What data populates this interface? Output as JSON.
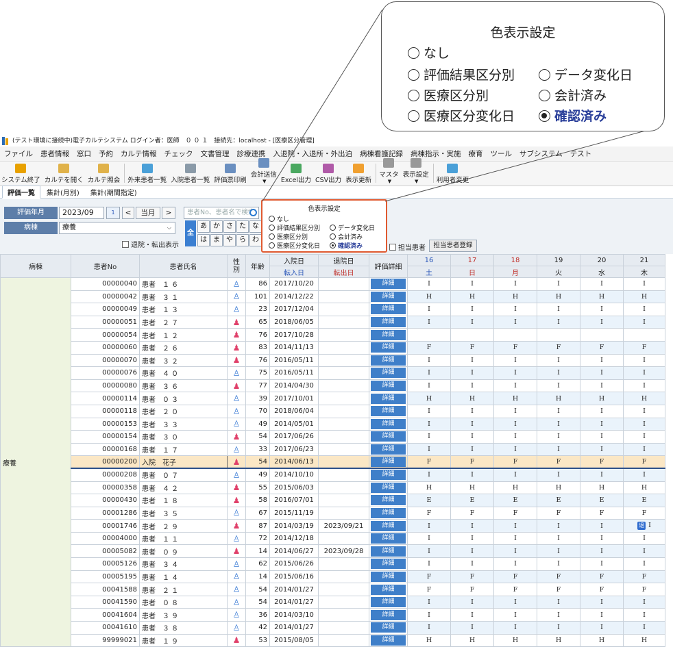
{
  "callout": {
    "title": "色表示設定",
    "options": [
      [
        "なし"
      ],
      [
        "評価結果区分別",
        "データ変化日"
      ],
      [
        "医療区分別",
        "会計済み"
      ],
      [
        "医療区分変化日",
        "確認済み"
      ]
    ]
  },
  "window": {
    "title": "(テスト環境に接続中)電子カルテシステム  ログイン者：医師　０ ０ １　接続先：localhost - [医療区分管理]"
  },
  "menu": [
    "ファイル",
    "患者情報",
    "窓口",
    "予約",
    "カルテ情報",
    "チェック",
    "文書管理",
    "診療連携",
    "入退院・入退所・外出泊",
    "病棟看護記録",
    "病棟指示・実施",
    "療育",
    "ツール",
    "サブシステム",
    "テスト"
  ],
  "toolbar": [
    "システム終了",
    "カルテを開く",
    "カルテ照会",
    "外来患者一覧",
    "入院患者一覧",
    "評価票印刷",
    "会計送信",
    "Excel出力",
    "CSV出力",
    "表示更新",
    "マスタ",
    "表示設定",
    "利用者変更"
  ],
  "tabs": [
    "評価一覧",
    "集計(月別)",
    "集計(期間指定)"
  ],
  "filters": {
    "month_label": "評価年月",
    "month_value": "2023/09",
    "calendar_glyph": "1",
    "prev": "<",
    "current": "当月",
    "next": ">",
    "ward_label": "病棟",
    "ward_value": "療養",
    "search_placeholder": "患者No、患者名で検索",
    "kana_all": "全",
    "kana_row1": [
      "あ",
      "か",
      "さ",
      "た",
      "な"
    ],
    "kana_row2": [
      "は",
      "ま",
      "や",
      "ら",
      "わ"
    ],
    "discharge_check": "退院・転出表示",
    "assigned_check": "担当患者",
    "assigned_button": "担当患者登録"
  },
  "color_panel": {
    "title": "色表示設定",
    "options": [
      [
        "なし"
      ],
      [
        "評価結果区分別",
        "データ変化日"
      ],
      [
        "医療区分別",
        "会計済み"
      ],
      [
        "医療区分変化日",
        "確認済み"
      ]
    ]
  },
  "grid": {
    "headers": {
      "ward": "病棟",
      "patient_no": "患者No",
      "patient_name": "患者氏名",
      "gender": "性別",
      "age": "年齢",
      "admit": "入院日",
      "transfer_in": "転入日",
      "discharge": "退院日",
      "transfer_out": "転出日",
      "detail": "評価詳細",
      "days": [
        {
          "d": "16",
          "w": "土"
        },
        {
          "d": "17",
          "w": "日"
        },
        {
          "d": "18",
          "w": "月"
        },
        {
          "d": "19",
          "w": "火"
        },
        {
          "d": "20",
          "w": "水"
        },
        {
          "d": "21",
          "w": "木"
        }
      ]
    },
    "ward_name": "療養",
    "detail_label": "詳細",
    "discharge_badge": "退",
    "rows": [
      {
        "no": "00000040",
        "name": "患者　１ ６",
        "g": "m",
        "age": "86",
        "admit": "2017/10/20",
        "out": "",
        "v": [
          "I",
          "I",
          "I",
          "I",
          "I",
          "I"
        ]
      },
      {
        "no": "00000042",
        "name": "患者　３ １",
        "g": "m",
        "age": "101",
        "admit": "2014/12/22",
        "out": "",
        "v": [
          "H",
          "H",
          "H",
          "H",
          "H",
          "H"
        ]
      },
      {
        "no": "00000049",
        "name": "患者　１ ３",
        "g": "m",
        "age": "23",
        "admit": "2017/12/04",
        "out": "",
        "v": [
          "I",
          "I",
          "I",
          "I",
          "I",
          "I"
        ]
      },
      {
        "no": "00000051",
        "name": "患者　２ ７",
        "g": "f",
        "age": "65",
        "admit": "2018/06/05",
        "out": "",
        "v": [
          "I",
          "I",
          "I",
          "I",
          "I",
          "I"
        ]
      },
      {
        "no": "00000054",
        "name": "患者　１ ２",
        "g": "f",
        "age": "76",
        "admit": "2017/10/28",
        "out": "",
        "v": [
          "",
          "",
          "",
          "",
          "",
          ""
        ]
      },
      {
        "no": "00000060",
        "name": "患者　２ ６",
        "g": "f",
        "age": "83",
        "admit": "2014/11/13",
        "out": "",
        "v": [
          "F",
          "F",
          "F",
          "F",
          "F",
          "F"
        ]
      },
      {
        "no": "00000070",
        "name": "患者　３ ２",
        "g": "f",
        "age": "76",
        "admit": "2016/05/11",
        "out": "",
        "v": [
          "I",
          "I",
          "I",
          "I",
          "I",
          "I"
        ]
      },
      {
        "no": "00000076",
        "name": "患者　４ ０",
        "g": "m",
        "age": "75",
        "admit": "2016/05/11",
        "out": "",
        "v": [
          "I",
          "I",
          "I",
          "I",
          "I",
          "I"
        ]
      },
      {
        "no": "00000080",
        "name": "患者　３ ６",
        "g": "f",
        "age": "77",
        "admit": "2014/04/30",
        "out": "",
        "v": [
          "I",
          "I",
          "I",
          "I",
          "I",
          "I"
        ]
      },
      {
        "no": "00000114",
        "name": "患者　０ ３",
        "g": "m",
        "age": "39",
        "admit": "2017/10/01",
        "out": "",
        "v": [
          "H",
          "H",
          "H",
          "H",
          "H",
          "H"
        ]
      },
      {
        "no": "00000118",
        "name": "患者　２ ０",
        "g": "m",
        "age": "70",
        "admit": "2018/06/04",
        "out": "",
        "v": [
          "I",
          "I",
          "I",
          "I",
          "I",
          "I"
        ]
      },
      {
        "no": "00000153",
        "name": "患者　３ ３",
        "g": "m",
        "age": "49",
        "admit": "2014/05/01",
        "out": "",
        "v": [
          "I",
          "I",
          "I",
          "I",
          "I",
          "I"
        ]
      },
      {
        "no": "00000154",
        "name": "患者　３ ０",
        "g": "f",
        "age": "54",
        "admit": "2017/06/26",
        "out": "",
        "v": [
          "I",
          "I",
          "I",
          "I",
          "I",
          "I"
        ]
      },
      {
        "no": "00000168",
        "name": "患者　１ ７",
        "g": "m",
        "age": "33",
        "admit": "2017/06/23",
        "out": "",
        "v": [
          "I",
          "I",
          "I",
          "I",
          "I",
          "I"
        ]
      },
      {
        "no": "00000200",
        "name": "入院　花子",
        "g": "f",
        "age": "54",
        "admit": "2014/06/13",
        "out": "",
        "v": [
          "F",
          "F",
          "F",
          "F",
          "F",
          "F"
        ],
        "selected": true
      },
      {
        "no": "00000208",
        "name": "患者　０ ７",
        "g": "m",
        "age": "49",
        "admit": "2014/10/10",
        "out": "",
        "v": [
          "I",
          "I",
          "I",
          "I",
          "I",
          "I"
        ]
      },
      {
        "no": "00000358",
        "name": "患者　４ ２",
        "g": "f",
        "age": "55",
        "admit": "2015/06/03",
        "out": "",
        "v": [
          "H",
          "H",
          "H",
          "H",
          "H",
          "H"
        ]
      },
      {
        "no": "00000430",
        "name": "患者　１ ８",
        "g": "f",
        "age": "58",
        "admit": "2016/07/01",
        "out": "",
        "v": [
          "E",
          "E",
          "E",
          "E",
          "E",
          "E"
        ]
      },
      {
        "no": "00001286",
        "name": "患者　３ ５",
        "g": "m",
        "age": "67",
        "admit": "2015/11/19",
        "out": "",
        "v": [
          "F",
          "F",
          "F",
          "F",
          "F",
          "F"
        ]
      },
      {
        "no": "00001746",
        "name": "患者　２ ９",
        "g": "f",
        "age": "87",
        "admit": "2014/03/19",
        "out": "2023/09/21",
        "v": [
          "I",
          "I",
          "I",
          "I",
          "I",
          "I"
        ],
        "badge_col": 5
      },
      {
        "no": "00004000",
        "name": "患者　１ １",
        "g": "m",
        "age": "72",
        "admit": "2014/12/18",
        "out": "",
        "v": [
          "I",
          "I",
          "I",
          "I",
          "I",
          "I"
        ]
      },
      {
        "no": "00005082",
        "name": "患者　０ ９",
        "g": "f",
        "age": "14",
        "admit": "2014/06/27",
        "out": "2023/09/28",
        "v": [
          "I",
          "I",
          "I",
          "I",
          "I",
          "I"
        ]
      },
      {
        "no": "00005126",
        "name": "患者　３ ４",
        "g": "m",
        "age": "62",
        "admit": "2015/06/26",
        "out": "",
        "v": [
          "I",
          "I",
          "I",
          "I",
          "I",
          "I"
        ]
      },
      {
        "no": "00005195",
        "name": "患者　１ ４",
        "g": "m",
        "age": "14",
        "admit": "2015/06/16",
        "out": "",
        "v": [
          "F",
          "F",
          "F",
          "F",
          "F",
          "F"
        ]
      },
      {
        "no": "00041588",
        "name": "患者　２ １",
        "g": "m",
        "age": "54",
        "admit": "2014/01/27",
        "out": "",
        "v": [
          "F",
          "F",
          "F",
          "F",
          "F",
          "F"
        ]
      },
      {
        "no": "00041590",
        "name": "患者　０ ８",
        "g": "m",
        "age": "54",
        "admit": "2014/01/27",
        "out": "",
        "v": [
          "I",
          "I",
          "I",
          "I",
          "I",
          "I"
        ]
      },
      {
        "no": "00041604",
        "name": "患者　３ ９",
        "g": "m",
        "age": "36",
        "admit": "2014/03/10",
        "out": "",
        "v": [
          "I",
          "I",
          "I",
          "I",
          "I",
          "I"
        ]
      },
      {
        "no": "00041610",
        "name": "患者　３ ８",
        "g": "m",
        "age": "42",
        "admit": "2014/01/27",
        "out": "",
        "v": [
          "I",
          "I",
          "I",
          "I",
          "I",
          "I"
        ]
      },
      {
        "no": "99999021",
        "name": "患者　１ ９",
        "g": "f",
        "age": "53",
        "admit": "2015/08/05",
        "out": "",
        "v": [
          "H",
          "H",
          "H",
          "H",
          "H",
          "H"
        ]
      }
    ]
  }
}
